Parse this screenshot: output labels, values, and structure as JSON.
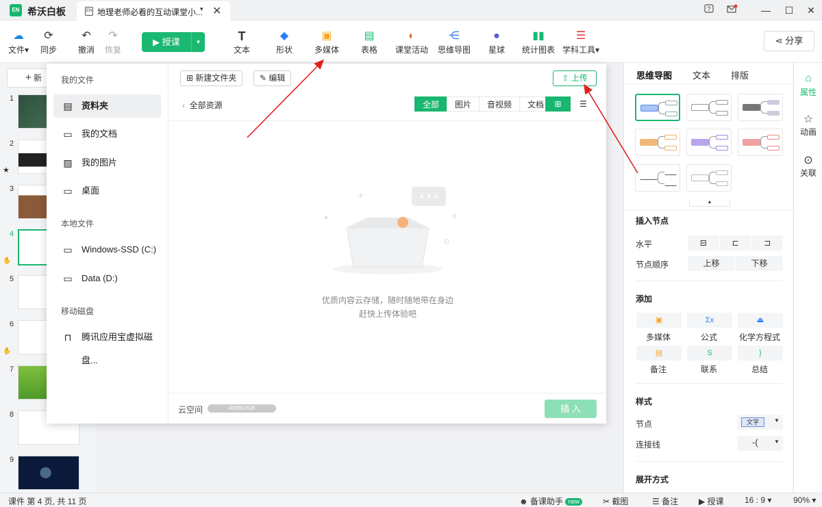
{
  "app": {
    "name": "希沃白板",
    "logo": "EN"
  },
  "tab": {
    "title": "地理老师必看的互动课堂小...",
    "dropdown": "▾",
    "close": "✕"
  },
  "toolbar": {
    "file": "文件",
    "sync": "同步",
    "undo": "撤消",
    "redo": "恢复",
    "teach": "授课",
    "text": "文本",
    "shape": "形状",
    "media": "多媒体",
    "table": "表格",
    "activity": "课堂活动",
    "mindmap": "思维导图",
    "planet": "星球",
    "chart": "统计图表",
    "subject": "学科工具",
    "share": "分享"
  },
  "slides": {
    "new_btn": "新",
    "numbers": [
      "1",
      "2",
      "3",
      "4",
      "5",
      "6",
      "7",
      "8",
      "9"
    ]
  },
  "dialog": {
    "my_files": "我的文件",
    "items": [
      "资料夹",
      "我的文档",
      "我的图片",
      "桌面"
    ],
    "local_files": "本地文件",
    "drives": [
      "Windows-SSD (C:)",
      "Data (D:)"
    ],
    "removable": "移动磁盘",
    "usb": [
      "腾讯应用宝虚拟磁盘..."
    ],
    "new_folder": "新建文件夹",
    "edit": "编辑",
    "upload": "上传",
    "breadcrumb": "全部资源",
    "filters": [
      "全部",
      "图片",
      "音视频",
      "文档"
    ],
    "empty_line1": "优质内容云存储，随时随地带在身边",
    "empty_line2": "赶快上传体验吧",
    "cloud_label": "云空间",
    "quota": "40MB/2GB",
    "insert": "插 入"
  },
  "right_panel": {
    "tabs": [
      "思维导图",
      "文本",
      "排版"
    ],
    "insert_node": "插入节点",
    "horizontal": "水平",
    "node_order": "节点顺序",
    "move_up": "上移",
    "move_down": "下移",
    "add": "添加",
    "add_items": [
      "多媒体",
      "公式",
      "化学方程式",
      "备注",
      "联系",
      "总结"
    ],
    "style": "样式",
    "node": "节点",
    "node_value": "文字",
    "connector": "连接线",
    "expand": "展开方式"
  },
  "rail": [
    "属性",
    "动画",
    "关联"
  ],
  "status": {
    "page_info": "课件 第 4 页, 共 11 页",
    "assistant": "备课助手",
    "new_tag": "new",
    "screenshot": "截图",
    "notes": "备注",
    "teach": "授课",
    "ratio": "16 : 9",
    "zoom": "90%"
  },
  "colors": {
    "accent": "#19b770",
    "arrow": "#e02020"
  }
}
